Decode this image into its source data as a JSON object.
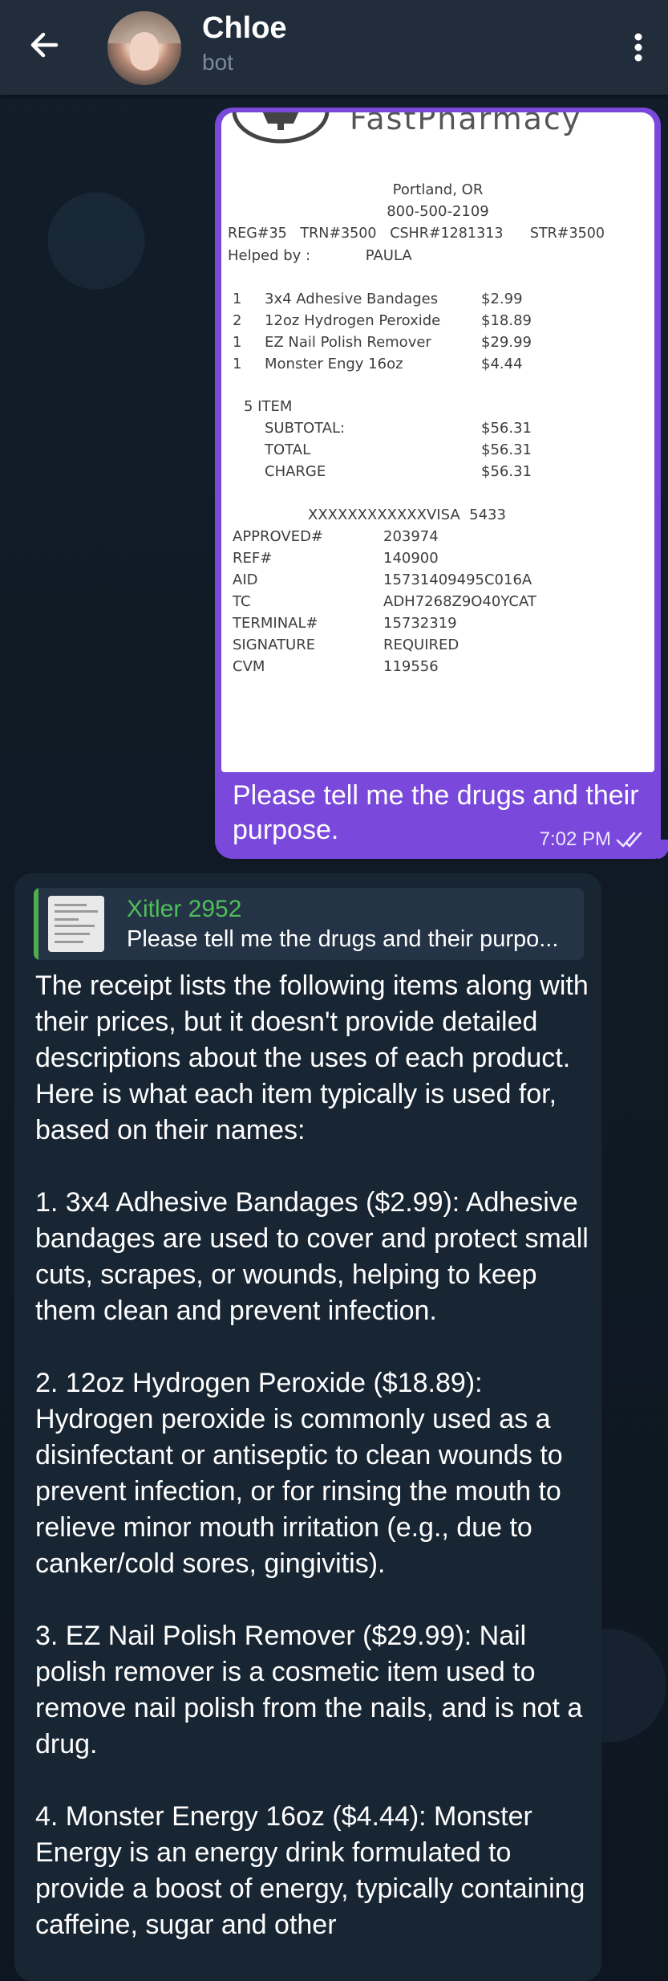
{
  "header": {
    "contact_name": "Chloe",
    "contact_status": "bot",
    "icons": {
      "back": "arrow-left-icon",
      "menu": "vertical-dots-icon"
    }
  },
  "outgoing_message": {
    "receipt": {
      "brand": "FastPharmacy",
      "location": "Portland, OR",
      "phone": "800-500-2109",
      "reg_line": "REG#35   TRN#3500   CSHR#1281313      STR#3500",
      "helped_by": "Helped by :            PAULA",
      "items": [
        {
          "qty": "1",
          "name": "3x4 Adhesive Bandages",
          "price": "$2.99"
        },
        {
          "qty": "2",
          "name": "12oz Hydrogen Peroxide",
          "price": "$18.89"
        },
        {
          "qty": "1",
          "name": "EZ Nail Polish Remover",
          "price": "$29.99"
        },
        {
          "qty": "1",
          "name": "Monster Engy 16oz",
          "price": "$4.44"
        }
      ],
      "item_count": "5 ITEM",
      "subtotal_label": "SUBTOTAL:",
      "subtotal": "$56.31",
      "total_label": "TOTAL",
      "total": "$56.31",
      "charge_label": "CHARGE",
      "charge": "$56.31",
      "card": "XXXXXXXXXXXXVISA  5433",
      "details": [
        {
          "label": "APPROVED#",
          "value": "203974"
        },
        {
          "label": "REF#",
          "value": "140900"
        },
        {
          "label": "AID",
          "value": "15731409495C016A"
        },
        {
          "label": "TC",
          "value": "ADH7268Z9O40YCAT"
        },
        {
          "label": "TERMINAL#",
          "value": "15732319"
        },
        {
          "label": "SIGNATURE",
          "value": "REQUIRED"
        },
        {
          "label": "CVM",
          "value": "119556"
        }
      ]
    },
    "text": "Please tell me the drugs and their purpose.",
    "time": "7:02 PM",
    "status_icon": "double-check-icon"
  },
  "incoming_message": {
    "reply": {
      "author": "Xitler 2952",
      "preview": "Please tell me the drugs and their purpo..."
    },
    "paragraphs": [
      "The receipt lists the following items along with their prices, but it doesn't provide detailed descriptions about the uses of each product. Here is what each item typically is used for, based on their names:",
      "1. 3x4 Adhesive Bandages ($2.99): Adhesive bandages are used to cover and protect small cuts, scrapes, or wounds, helping to keep them clean and prevent infection.",
      "2. 12oz Hydrogen Peroxide ($18.89): Hydrogen peroxide is commonly used as a disinfectant or antiseptic to clean wounds to prevent infection, or for rinsing the mouth to relieve minor mouth irritation (e.g., due to canker/cold sores, gingivitis).",
      "3. EZ Nail Polish Remover ($29.99): Nail polish remover is a cosmetic item used to remove nail polish from the nails, and is not a drug.",
      "4. Monster Energy 16oz ($4.44): Monster Energy is an energy drink formulated to provide a boost of energy, typically containing caffeine, sugar and other"
    ]
  },
  "colors": {
    "background": "#0e1621",
    "header": "#212d3b",
    "outgoing_bubble": "#7a49dc",
    "incoming_bubble": "#182533",
    "reply_accent": "#4fae4e"
  }
}
